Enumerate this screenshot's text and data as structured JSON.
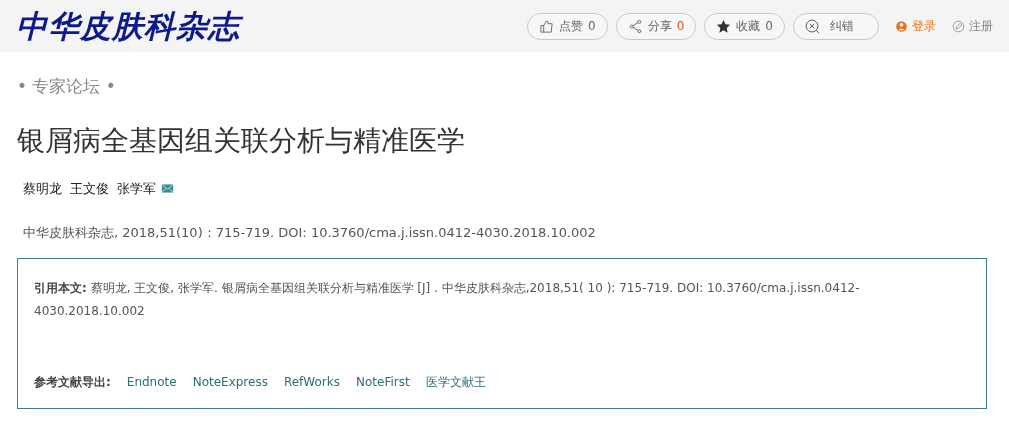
{
  "logo": "中华皮肤科杂志",
  "toolbar": [
    {
      "kind": "like",
      "label": "点赞",
      "count": "0",
      "count_highlight": false
    },
    {
      "kind": "share",
      "label": "分享",
      "count": "0",
      "count_highlight": true
    },
    {
      "kind": "favorite",
      "label": "收藏",
      "count": "0",
      "count_highlight": false
    },
    {
      "kind": "report",
      "label": "纠错"
    }
  ],
  "account_links": [
    {
      "kind": "login",
      "label": "登录"
    },
    {
      "kind": "register",
      "label": "注册"
    }
  ],
  "section": "• 专家论坛 •",
  "title": "银屑病全基因组关联分析与精准医学",
  "authors": [
    {
      "name": "蔡明龙",
      "email": false
    },
    {
      "name": "王文俊",
      "email": false
    },
    {
      "name": "张学军",
      "email": true
    }
  ],
  "citation": "中华皮肤科杂志, 2018,51(10)：715-719. DOI: 10.3760/cma.j.issn.0412-4030.2018.10.002",
  "cite_box": {
    "text": "**引用本文:** 蔡明龙, 王文俊, 张学军. 银屑病全基因组关联分析与精准医学 [J] . 中华皮肤科杂志,2018,51( 10 ): 715-719. DOI: 10.3760/cma.j.issn.0412-4030.2018.10.002",
    "export_label": "参考文献导出:",
    "export_links": [
      "Endnote",
      "NoteExpress",
      "RefWorks",
      "NoteFirst",
      "医学文献王"
    ]
  }
}
